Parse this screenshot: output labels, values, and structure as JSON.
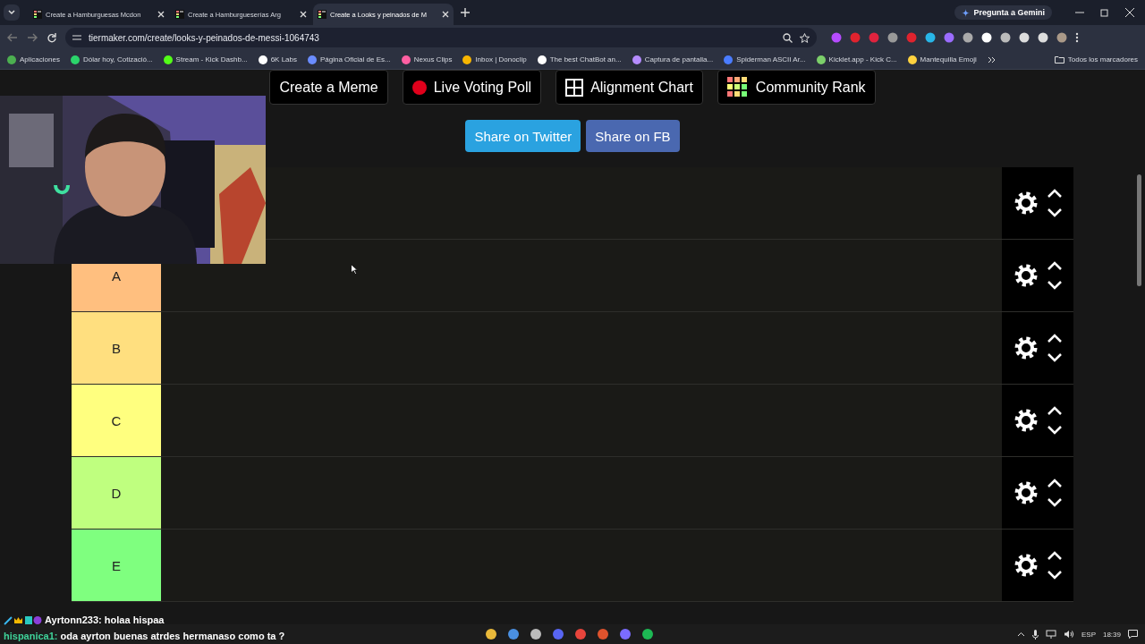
{
  "browser": {
    "tabs": [
      {
        "title": "Create a Hamburguesas Mcdon",
        "selected": false
      },
      {
        "title": "Create a Hamburgueserías Arg",
        "selected": false
      },
      {
        "title": "Create a Looks y peinados de M",
        "selected": true
      }
    ],
    "gemini": "Pregunta a Gemini",
    "url": "tiermaker.com/create/looks-y-peinados-de-messi-1064743",
    "bookmarks": [
      "Aplicaciones",
      "Dólar hoy, Cotizació...",
      "Stream - Kick Dashb...",
      "6K Labs",
      "Página Oficial de Es...",
      "Nexus Clips",
      "Inbox | Donoclip",
      "The best ChatBot an...",
      "Captura de pantalla...",
      "Spiderman ASCII Ar...",
      "Kicklet.app - Kick C...",
      "Mantequilla Emoji"
    ],
    "all_bookmarks": "Todos los marcadores"
  },
  "page": {
    "actions": [
      {
        "label": "Create a Meme",
        "kind": "plain"
      },
      {
        "label": "Live Voting Poll",
        "kind": "poll"
      },
      {
        "label": "Alignment Chart",
        "kind": "alignment"
      },
      {
        "label": "Community Rank",
        "kind": "rank"
      }
    ],
    "share": [
      {
        "label": "Share on Twitter",
        "kind": "twitter"
      },
      {
        "label": "Share on FB",
        "kind": "facebook"
      }
    ],
    "tiers": [
      {
        "kind": "covered"
      },
      {
        "kind": "labeled",
        "label": "A",
        "color": "#ffbf7f"
      },
      {
        "kind": "labeled",
        "label": "B",
        "color": "#ffdf7f"
      },
      {
        "kind": "labeled",
        "label": "C",
        "color": "#ffff7f"
      },
      {
        "kind": "labeled",
        "label": "D",
        "color": "#bfff7f"
      },
      {
        "kind": "labeled",
        "label": "E",
        "color": "#7fff7f"
      }
    ]
  },
  "chat": [
    {
      "user": "Ayrtonn233:",
      "text": "holaa hispaa",
      "color": "#ffffff",
      "badges": true
    },
    {
      "user": "hispanica1:",
      "text": "oda ayrton buenas atrdes hermanaso como ta ?",
      "color": "#3fd39a",
      "badges": false
    }
  ],
  "taskbar": {
    "language": "ESP",
    "time": "18:39"
  }
}
